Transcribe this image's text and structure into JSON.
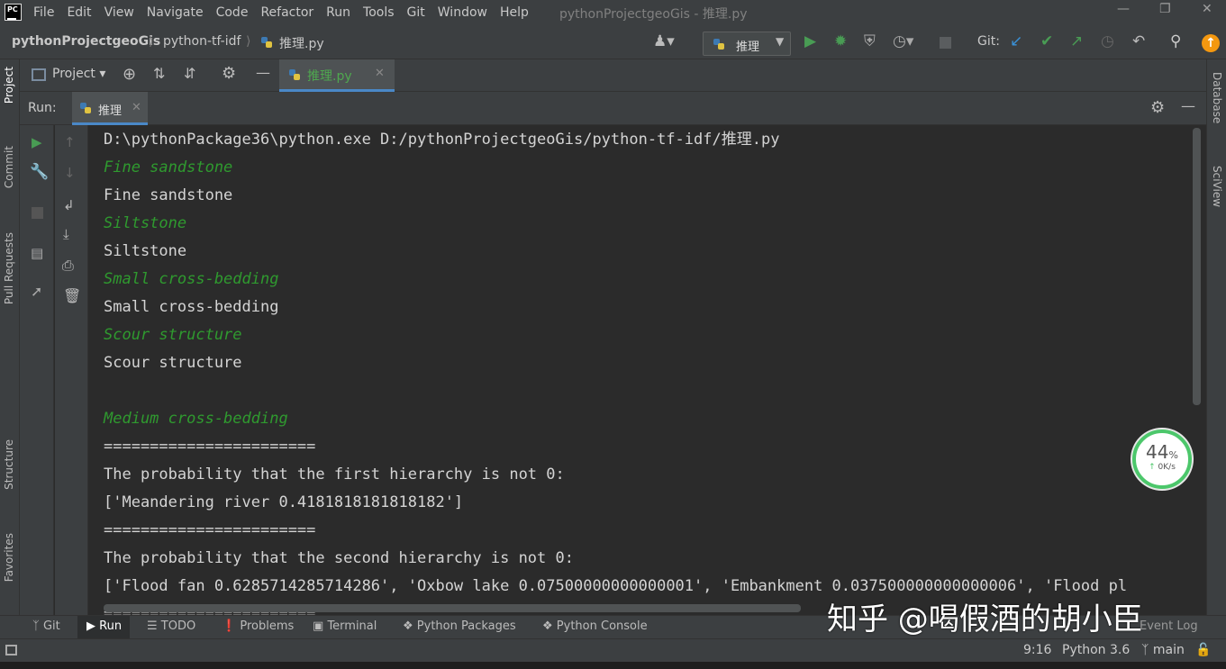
{
  "menubar": {
    "logo": "PC",
    "items": [
      "File",
      "Edit",
      "View",
      "Navigate",
      "Code",
      "Refactor",
      "Run",
      "Tools",
      "Git",
      "Window",
      "Help"
    ],
    "window_title": "pythonProjectgeoGis - 推理.py"
  },
  "navbar": {
    "breadcrumb": [
      "pythonProjectgeoGis",
      "python-tf-idf",
      "推理.py"
    ],
    "run_config": "推理",
    "git_label": "Git:"
  },
  "tool_window": {
    "project_label": "Project",
    "editor_tab": "推理.py"
  },
  "run_panel": {
    "run_label": "Run:",
    "run_tab": "推理"
  },
  "left_strip": [
    "Project",
    "Commit",
    "Pull Requests",
    "Structure",
    "Favorites"
  ],
  "right_strip": [
    "Database",
    "SciView"
  ],
  "console": {
    "lines": [
      {
        "text": "D:\\pythonPackage36\\python.exe D:/pythonProjectgeoGis/python-tf-idf/推理.py",
        "style": "white"
      },
      {
        "text": "Fine sandstone",
        "style": "green"
      },
      {
        "text": "Fine sandstone",
        "style": "white"
      },
      {
        "text": "Siltstone",
        "style": "green"
      },
      {
        "text": "Siltstone",
        "style": "white"
      },
      {
        "text": "Small cross-bedding",
        "style": "green"
      },
      {
        "text": "Small cross-bedding",
        "style": "white"
      },
      {
        "text": "Scour structure",
        "style": "green"
      },
      {
        "text": "Scour structure",
        "style": "white"
      },
      {
        "text": "",
        "style": "white"
      },
      {
        "text": "Medium cross-bedding",
        "style": "green"
      },
      {
        "text": "=======================",
        "style": "white"
      },
      {
        "text": "The probability that the first hierarchy is not 0:",
        "style": "white"
      },
      {
        "text": "['Meandering river 0.4181818181818182']",
        "style": "white"
      },
      {
        "text": "=======================",
        "style": "white"
      },
      {
        "text": "The probability that the second hierarchy is not 0:",
        "style": "white"
      },
      {
        "text": "['Flood fan 0.6285714285714286', 'Oxbow lake 0.07500000000000001', 'Embankment 0.037500000000000006', 'Flood pl",
        "style": "white"
      },
      {
        "text": "=======================",
        "style": "white"
      }
    ]
  },
  "bottom_tabs": [
    "Git",
    "Run",
    "TODO",
    "Problems",
    "Terminal",
    "Python Packages",
    "Python Console"
  ],
  "status": {
    "position": "9:16",
    "interpreter": "Python 3.6",
    "branch": "main",
    "event_log": "Event Log"
  },
  "gauge": {
    "percent": "44",
    "percent_sign": "%",
    "rate": "0K/s",
    "level": 0.44
  },
  "watermark": "知乎 @喝假酒的胡小臣",
  "colors": {
    "accent_green": "#2f9a2f",
    "panel": "#3c3f41",
    "editor_bg": "#2b2b2b",
    "run_green": "#499c54"
  }
}
